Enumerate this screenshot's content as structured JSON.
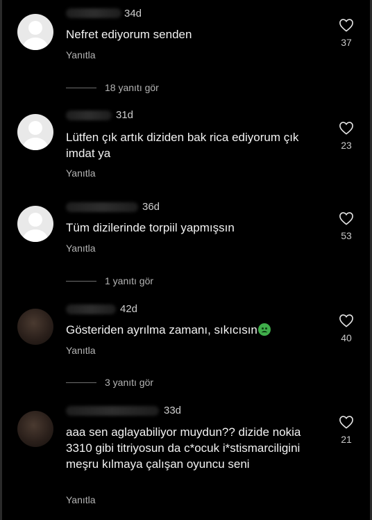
{
  "comments": [
    {
      "time": "34d",
      "text": "Nefret ediyorum senden",
      "reply_label": "Yanıtla",
      "likes": "37",
      "view_replies": "18 yanıtı gör"
    },
    {
      "time": "31d",
      "text": "Lütfen çık artık diziden bak rica ediyorum çık imdat ya",
      "reply_label": "Yanıtla",
      "likes": "23"
    },
    {
      "time": "36d",
      "text": "Tüm dizilerinde torpiil yapmışsın",
      "reply_label": "Yanıtla",
      "likes": "53",
      "view_replies": "1 yanıtı gör"
    },
    {
      "time": "42d",
      "text": "Gösteriden ayrılma zamanı, sıkıcısın",
      "emoji": "nauseated-face-icon",
      "reply_label": "Yanıtla",
      "likes": "40",
      "view_replies": "3 yanıtı gör"
    },
    {
      "time": "33d",
      "text": "aaa sen aglayabiliyor muydun?? dizide nokia 3310 gibi titriyosun da c*ocuk i*stismarciligini meşru kılmaya çalışan oyuncu seni",
      "reply_label": "Yanıtla",
      "likes": "21"
    }
  ],
  "icons": {
    "like": "heart-outline-icon",
    "avatar_default": "default-avatar-icon"
  },
  "colors": {
    "background": "#000000",
    "text": "#f2f2f2",
    "muted": "#b5b5b5"
  }
}
